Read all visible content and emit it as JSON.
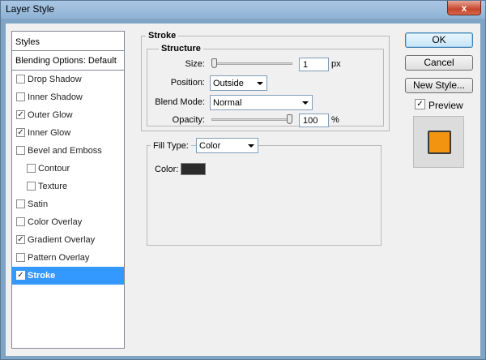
{
  "window": {
    "title": "Layer Style",
    "close_glyph": "x"
  },
  "left_panel": {
    "header": "Styles",
    "blending_options": "Blending Options: Default",
    "items": [
      {
        "label": "Drop Shadow",
        "checked": false,
        "indent": false,
        "selected": false
      },
      {
        "label": "Inner Shadow",
        "checked": false,
        "indent": false,
        "selected": false
      },
      {
        "label": "Outer Glow",
        "checked": true,
        "indent": false,
        "selected": false
      },
      {
        "label": "Inner Glow",
        "checked": true,
        "indent": false,
        "selected": false
      },
      {
        "label": "Bevel and Emboss",
        "checked": false,
        "indent": false,
        "selected": false
      },
      {
        "label": "Contour",
        "checked": false,
        "indent": true,
        "selected": false
      },
      {
        "label": "Texture",
        "checked": false,
        "indent": true,
        "selected": false
      },
      {
        "label": "Satin",
        "checked": false,
        "indent": false,
        "selected": false
      },
      {
        "label": "Color Overlay",
        "checked": false,
        "indent": false,
        "selected": false
      },
      {
        "label": "Gradient Overlay",
        "checked": true,
        "indent": false,
        "selected": false
      },
      {
        "label": "Pattern Overlay",
        "checked": false,
        "indent": false,
        "selected": false
      },
      {
        "label": "Stroke",
        "checked": true,
        "indent": false,
        "selected": true
      }
    ]
  },
  "stroke": {
    "group_title": "Stroke",
    "structure_title": "Structure",
    "size_label": "Size:",
    "size_value": "1",
    "size_unit": "px",
    "size_slider_fraction": 0.0,
    "position_label": "Position:",
    "position_value": "Outside",
    "blend_mode_label": "Blend Mode:",
    "blend_mode_value": "Normal",
    "opacity_label": "Opacity:",
    "opacity_value": "100",
    "opacity_unit": "%",
    "opacity_slider_fraction": 1.0,
    "fill_type_label": "Fill Type:",
    "fill_type_value": "Color",
    "color_label": "Color:",
    "color_value": "#2b2b2b"
  },
  "buttons": {
    "ok": "OK",
    "cancel": "Cancel",
    "new_style": "New Style...",
    "preview_label": "Preview",
    "preview_checked": true
  },
  "colors": {
    "selection": "#3399ff",
    "preview_fill": "#f29410"
  }
}
